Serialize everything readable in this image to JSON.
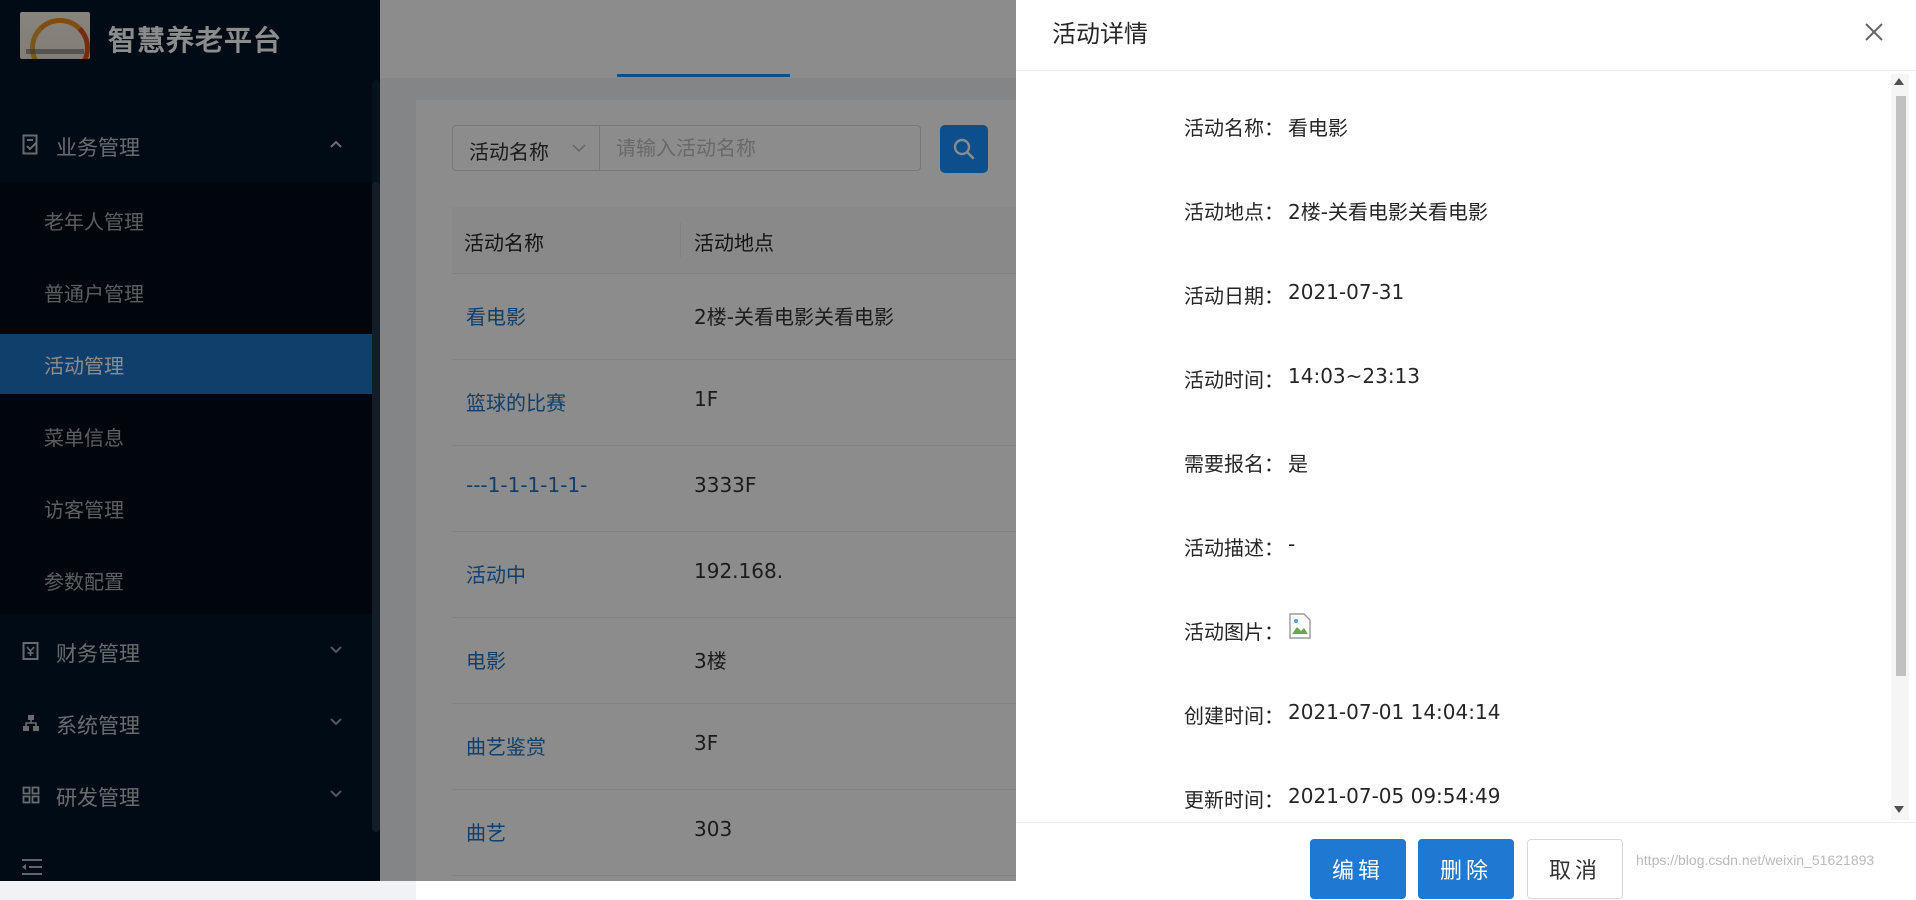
{
  "app": {
    "title": "智慧养老平台"
  },
  "sidebar": {
    "groups": [
      {
        "label": "业务管理",
        "icon": "doc-check-icon",
        "expanded": true
      },
      {
        "label": "财务管理",
        "icon": "finance-icon",
        "expanded": false
      },
      {
        "label": "系统管理",
        "icon": "org-chart-icon",
        "expanded": false
      },
      {
        "label": "研发管理",
        "icon": "grid-icon",
        "expanded": false
      }
    ],
    "sub_items": [
      {
        "label": "老年人管理",
        "active": false
      },
      {
        "label": "普通户管理",
        "active": false
      },
      {
        "label": "活动管理",
        "active": true
      },
      {
        "label": "菜单信息",
        "active": false
      },
      {
        "label": "访客管理",
        "active": false
      },
      {
        "label": "参数配置",
        "active": false
      }
    ]
  },
  "search": {
    "field_select": "活动名称",
    "placeholder": "请输入活动名称"
  },
  "table": {
    "headers": [
      "活动名称",
      "活动地点"
    ],
    "rows": [
      [
        "看电影",
        "2楼-关看电影关看电影"
      ],
      [
        "篮球的比赛",
        "1F"
      ],
      [
        "---1-1-1-1-1-",
        "3333F"
      ],
      [
        "活动中",
        "192.168."
      ],
      [
        "电影",
        "3楼"
      ],
      [
        "曲艺鉴赏",
        "3F"
      ],
      [
        "曲艺",
        "303"
      ]
    ]
  },
  "drawer": {
    "title": "活动详情",
    "fields": [
      {
        "label": "活动名称：",
        "value": "看电影"
      },
      {
        "label": "活动地点：",
        "value": "2楼-关看电影关看电影"
      },
      {
        "label": "活动日期：",
        "value": "2021-07-31"
      },
      {
        "label": "活动时间：",
        "value": "14:03~23:13"
      },
      {
        "label": "需要报名：",
        "value": "是"
      },
      {
        "label": "活动描述：",
        "value": "-"
      },
      {
        "label": "活动图片：",
        "value": ""
      },
      {
        "label": "创建时间：",
        "value": "2021-07-01 14:04:14"
      },
      {
        "label": "更新时间：",
        "value": "2021-07-05 09:54:49"
      }
    ],
    "buttons": {
      "edit": "编辑",
      "delete": "删除",
      "cancel": "取消"
    }
  },
  "watermark": "https://blog.csdn.net/weixin_51621893",
  "colors": {
    "sidebar_bg": "#001529",
    "active_item": "#1f73c4",
    "primary": "#1890ff",
    "link": "#1f73c4"
  }
}
